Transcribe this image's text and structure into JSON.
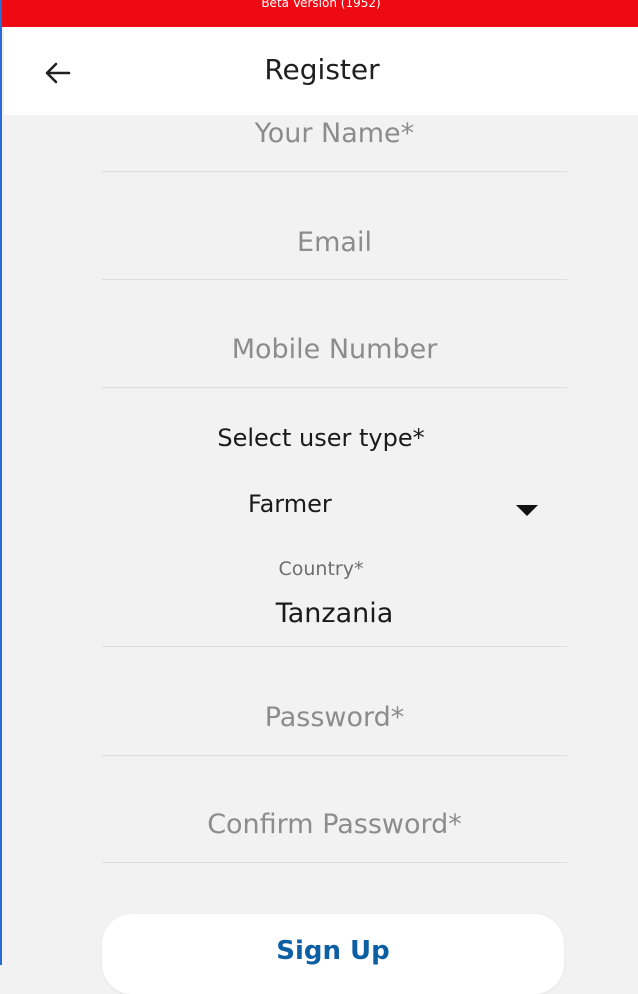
{
  "banner": {
    "text": "Beta Version (1952)",
    "color": "#ee0a12"
  },
  "appbar": {
    "title": "Register",
    "back_icon": "arrow-left-icon"
  },
  "form": {
    "name_placeholder": "Your Name*",
    "email_placeholder": "Email",
    "mobile_placeholder": "Mobile Number",
    "user_type_label": "Select user type*",
    "user_type_value": "Farmer",
    "country_label": "Country*",
    "country_value": "Tanzania",
    "password_placeholder": "Password*",
    "confirm_password_placeholder": "Confirm Password*"
  },
  "actions": {
    "signup_label": "Sign Up",
    "accent": "#0d5fa4"
  }
}
